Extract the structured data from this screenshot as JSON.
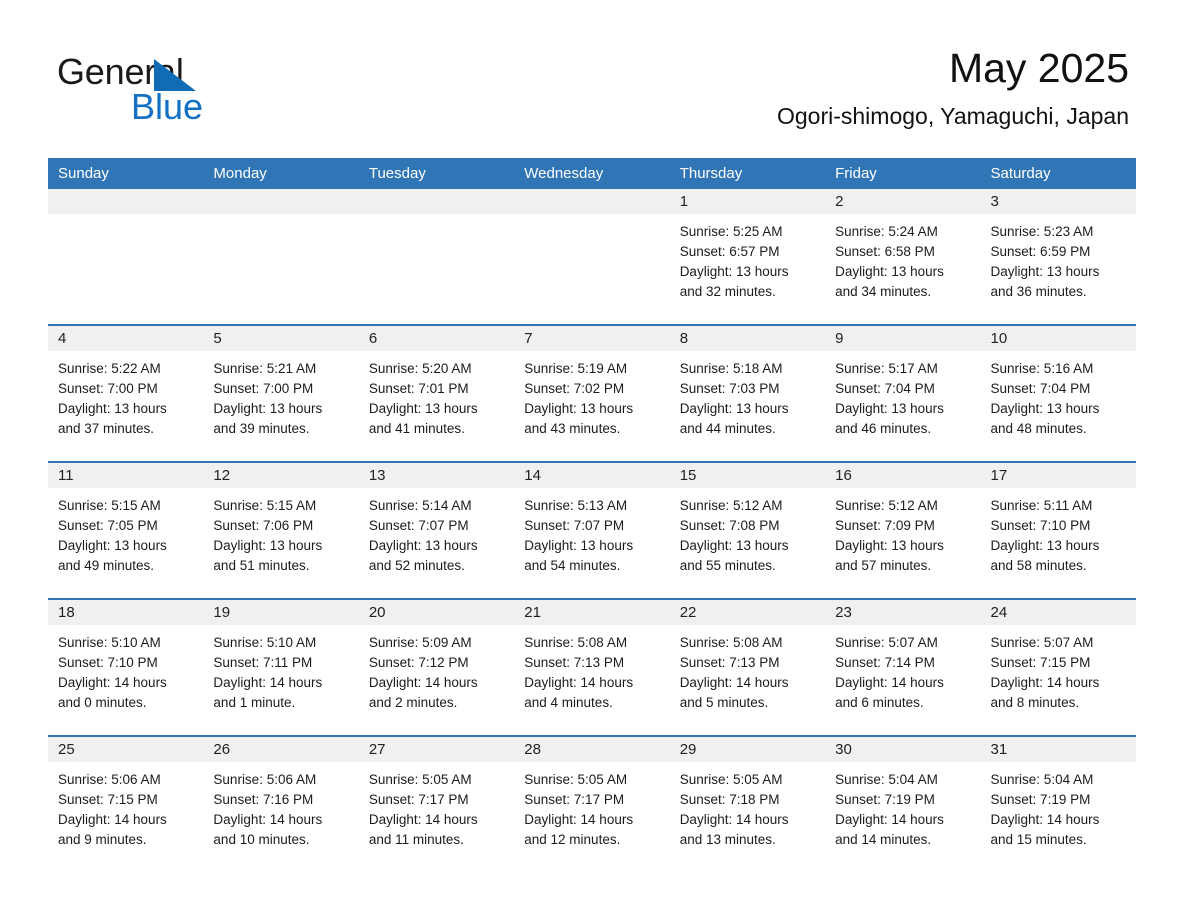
{
  "logo": {
    "word_one": "General",
    "word_two": "Blue",
    "triangle": "blue-triangle-icon",
    "accent_color": "#1271c4"
  },
  "header": {
    "title": "May 2025",
    "subtitle": "Ogori-shimogo, Yamaguchi, Japan"
  },
  "theme": {
    "header_blue": "#3075b5",
    "daynum_gray": "#f0f0f0",
    "text": "#1c1c1c"
  },
  "calendar": {
    "weekdays": [
      "Sunday",
      "Monday",
      "Tuesday",
      "Wednesday",
      "Thursday",
      "Friday",
      "Saturday"
    ],
    "weeks": [
      [
        {
          "day": "",
          "blank": true,
          "sunrise": "",
          "sunset": "",
          "daylight_line1": "",
          "daylight_line2": ""
        },
        {
          "day": "",
          "blank": true,
          "sunrise": "",
          "sunset": "",
          "daylight_line1": "",
          "daylight_line2": ""
        },
        {
          "day": "",
          "blank": true,
          "sunrise": "",
          "sunset": "",
          "daylight_line1": "",
          "daylight_line2": ""
        },
        {
          "day": "",
          "blank": true,
          "sunrise": "",
          "sunset": "",
          "daylight_line1": "",
          "daylight_line2": ""
        },
        {
          "day": "1",
          "blank": false,
          "sunrise": "Sunrise: 5:25 AM",
          "sunset": "Sunset: 6:57 PM",
          "daylight_line1": "Daylight: 13 hours",
          "daylight_line2": "and 32 minutes."
        },
        {
          "day": "2",
          "blank": false,
          "sunrise": "Sunrise: 5:24 AM",
          "sunset": "Sunset: 6:58 PM",
          "daylight_line1": "Daylight: 13 hours",
          "daylight_line2": "and 34 minutes."
        },
        {
          "day": "3",
          "blank": false,
          "sunrise": "Sunrise: 5:23 AM",
          "sunset": "Sunset: 6:59 PM",
          "daylight_line1": "Daylight: 13 hours",
          "daylight_line2": "and 36 minutes."
        }
      ],
      [
        {
          "day": "4",
          "blank": false,
          "sunrise": "Sunrise: 5:22 AM",
          "sunset": "Sunset: 7:00 PM",
          "daylight_line1": "Daylight: 13 hours",
          "daylight_line2": "and 37 minutes."
        },
        {
          "day": "5",
          "blank": false,
          "sunrise": "Sunrise: 5:21 AM",
          "sunset": "Sunset: 7:00 PM",
          "daylight_line1": "Daylight: 13 hours",
          "daylight_line2": "and 39 minutes."
        },
        {
          "day": "6",
          "blank": false,
          "sunrise": "Sunrise: 5:20 AM",
          "sunset": "Sunset: 7:01 PM",
          "daylight_line1": "Daylight: 13 hours",
          "daylight_line2": "and 41 minutes."
        },
        {
          "day": "7",
          "blank": false,
          "sunrise": "Sunrise: 5:19 AM",
          "sunset": "Sunset: 7:02 PM",
          "daylight_line1": "Daylight: 13 hours",
          "daylight_line2": "and 43 minutes."
        },
        {
          "day": "8",
          "blank": false,
          "sunrise": "Sunrise: 5:18 AM",
          "sunset": "Sunset: 7:03 PM",
          "daylight_line1": "Daylight: 13 hours",
          "daylight_line2": "and 44 minutes."
        },
        {
          "day": "9",
          "blank": false,
          "sunrise": "Sunrise: 5:17 AM",
          "sunset": "Sunset: 7:04 PM",
          "daylight_line1": "Daylight: 13 hours",
          "daylight_line2": "and 46 minutes."
        },
        {
          "day": "10",
          "blank": false,
          "sunrise": "Sunrise: 5:16 AM",
          "sunset": "Sunset: 7:04 PM",
          "daylight_line1": "Daylight: 13 hours",
          "daylight_line2": "and 48 minutes."
        }
      ],
      [
        {
          "day": "11",
          "blank": false,
          "sunrise": "Sunrise: 5:15 AM",
          "sunset": "Sunset: 7:05 PM",
          "daylight_line1": "Daylight: 13 hours",
          "daylight_line2": "and 49 minutes."
        },
        {
          "day": "12",
          "blank": false,
          "sunrise": "Sunrise: 5:15 AM",
          "sunset": "Sunset: 7:06 PM",
          "daylight_line1": "Daylight: 13 hours",
          "daylight_line2": "and 51 minutes."
        },
        {
          "day": "13",
          "blank": false,
          "sunrise": "Sunrise: 5:14 AM",
          "sunset": "Sunset: 7:07 PM",
          "daylight_line1": "Daylight: 13 hours",
          "daylight_line2": "and 52 minutes."
        },
        {
          "day": "14",
          "blank": false,
          "sunrise": "Sunrise: 5:13 AM",
          "sunset": "Sunset: 7:07 PM",
          "daylight_line1": "Daylight: 13 hours",
          "daylight_line2": "and 54 minutes."
        },
        {
          "day": "15",
          "blank": false,
          "sunrise": "Sunrise: 5:12 AM",
          "sunset": "Sunset: 7:08 PM",
          "daylight_line1": "Daylight: 13 hours",
          "daylight_line2": "and 55 minutes."
        },
        {
          "day": "16",
          "blank": false,
          "sunrise": "Sunrise: 5:12 AM",
          "sunset": "Sunset: 7:09 PM",
          "daylight_line1": "Daylight: 13 hours",
          "daylight_line2": "and 57 minutes."
        },
        {
          "day": "17",
          "blank": false,
          "sunrise": "Sunrise: 5:11 AM",
          "sunset": "Sunset: 7:10 PM",
          "daylight_line1": "Daylight: 13 hours",
          "daylight_line2": "and 58 minutes."
        }
      ],
      [
        {
          "day": "18",
          "blank": false,
          "sunrise": "Sunrise: 5:10 AM",
          "sunset": "Sunset: 7:10 PM",
          "daylight_line1": "Daylight: 14 hours",
          "daylight_line2": "and 0 minutes."
        },
        {
          "day": "19",
          "blank": false,
          "sunrise": "Sunrise: 5:10 AM",
          "sunset": "Sunset: 7:11 PM",
          "daylight_line1": "Daylight: 14 hours",
          "daylight_line2": "and 1 minute."
        },
        {
          "day": "20",
          "blank": false,
          "sunrise": "Sunrise: 5:09 AM",
          "sunset": "Sunset: 7:12 PM",
          "daylight_line1": "Daylight: 14 hours",
          "daylight_line2": "and 2 minutes."
        },
        {
          "day": "21",
          "blank": false,
          "sunrise": "Sunrise: 5:08 AM",
          "sunset": "Sunset: 7:13 PM",
          "daylight_line1": "Daylight: 14 hours",
          "daylight_line2": "and 4 minutes."
        },
        {
          "day": "22",
          "blank": false,
          "sunrise": "Sunrise: 5:08 AM",
          "sunset": "Sunset: 7:13 PM",
          "daylight_line1": "Daylight: 14 hours",
          "daylight_line2": "and 5 minutes."
        },
        {
          "day": "23",
          "blank": false,
          "sunrise": "Sunrise: 5:07 AM",
          "sunset": "Sunset: 7:14 PM",
          "daylight_line1": "Daylight: 14 hours",
          "daylight_line2": "and 6 minutes."
        },
        {
          "day": "24",
          "blank": false,
          "sunrise": "Sunrise: 5:07 AM",
          "sunset": "Sunset: 7:15 PM",
          "daylight_line1": "Daylight: 14 hours",
          "daylight_line2": "and 8 minutes."
        }
      ],
      [
        {
          "day": "25",
          "blank": false,
          "sunrise": "Sunrise: 5:06 AM",
          "sunset": "Sunset: 7:15 PM",
          "daylight_line1": "Daylight: 14 hours",
          "daylight_line2": "and 9 minutes."
        },
        {
          "day": "26",
          "blank": false,
          "sunrise": "Sunrise: 5:06 AM",
          "sunset": "Sunset: 7:16 PM",
          "daylight_line1": "Daylight: 14 hours",
          "daylight_line2": "and 10 minutes."
        },
        {
          "day": "27",
          "blank": false,
          "sunrise": "Sunrise: 5:05 AM",
          "sunset": "Sunset: 7:17 PM",
          "daylight_line1": "Daylight: 14 hours",
          "daylight_line2": "and 11 minutes."
        },
        {
          "day": "28",
          "blank": false,
          "sunrise": "Sunrise: 5:05 AM",
          "sunset": "Sunset: 7:17 PM",
          "daylight_line1": "Daylight: 14 hours",
          "daylight_line2": "and 12 minutes."
        },
        {
          "day": "29",
          "blank": false,
          "sunrise": "Sunrise: 5:05 AM",
          "sunset": "Sunset: 7:18 PM",
          "daylight_line1": "Daylight: 14 hours",
          "daylight_line2": "and 13 minutes."
        },
        {
          "day": "30",
          "blank": false,
          "sunrise": "Sunrise: 5:04 AM",
          "sunset": "Sunset: 7:19 PM",
          "daylight_line1": "Daylight: 14 hours",
          "daylight_line2": "and 14 minutes."
        },
        {
          "day": "31",
          "blank": false,
          "sunrise": "Sunrise: 5:04 AM",
          "sunset": "Sunset: 7:19 PM",
          "daylight_line1": "Daylight: 14 hours",
          "daylight_line2": "and 15 minutes."
        }
      ]
    ]
  }
}
